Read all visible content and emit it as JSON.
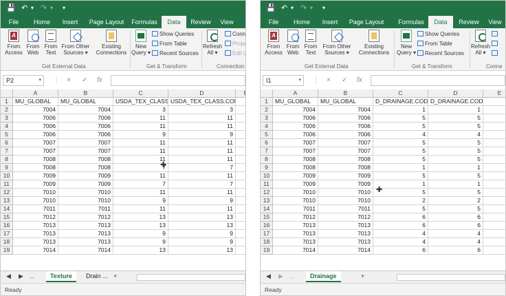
{
  "qat": {
    "save_icon": "save-icon",
    "undo_icon": "undo-icon",
    "redo_icon": "redo-icon",
    "customize_icon": "customize-qat-icon"
  },
  "tabs": [
    "File",
    "Home",
    "Insert",
    "Page Layout",
    "Formulas",
    "Data",
    "Review",
    "View"
  ],
  "ribbon": {
    "from_access": "From\nAccess",
    "from_web": "From\nWeb",
    "from_text": "From\nText",
    "from_other": "From Other\nSources ▾",
    "existing": "Existing\nConnections",
    "get_external": "Get External Data",
    "new_query": "New\nQuery ▾",
    "show_queries": "Show Queries",
    "from_table": "From Table",
    "recent_sources": "Recent Sources",
    "get_transform": "Get & Transform",
    "refresh": "Refresh\nAll ▾",
    "connections_a": "Conne",
    "properties_a": "Prope",
    "edit_links_a": "Edit Li",
    "connections_label_a": "Connection",
    "connections_label_b": "Conne"
  },
  "formula_bar": {
    "a_cell": "P2",
    "b_cell": "I1",
    "cancel": "×",
    "enter": "✓",
    "fx": "fx"
  },
  "col_headers_a": [
    "A",
    "B",
    "C",
    "D",
    "E"
  ],
  "col_headers_b": [
    "A",
    "B",
    "C",
    "D",
    "E"
  ],
  "header_row_a": [
    "MU_GLOBAL",
    "MU_GLOBAL",
    "USDA_TEX_CLASS.CO",
    "USDA_TEX_CLASS.CODE",
    ""
  ],
  "header_row_b": [
    "MU_GLOBAL",
    "MU_GLOBAL",
    "D_DRAINAGE.CODE",
    "D_DRAINAGE.CODE",
    ""
  ],
  "rows_a": [
    [
      "7004",
      "7004",
      "3",
      "3"
    ],
    [
      "7006",
      "7006",
      "11",
      "11"
    ],
    [
      "7006",
      "7006",
      "11",
      "11"
    ],
    [
      "7006",
      "7006",
      "9",
      "9"
    ],
    [
      "7007",
      "7007",
      "11",
      "11"
    ],
    [
      "7007",
      "7007",
      "11",
      "11"
    ],
    [
      "7008",
      "7008",
      "11",
      "11"
    ],
    [
      "7008",
      "7008",
      "7",
      "7"
    ],
    [
      "7009",
      "7009",
      "11",
      "11"
    ],
    [
      "7009",
      "7009",
      "7",
      "7"
    ],
    [
      "7010",
      "7010",
      "11",
      "11"
    ],
    [
      "7010",
      "7010",
      "9",
      "9"
    ],
    [
      "7011",
      "7011",
      "11",
      "11"
    ],
    [
      "7012",
      "7012",
      "13",
      "13"
    ],
    [
      "7013",
      "7013",
      "13",
      "13"
    ],
    [
      "7013",
      "7013",
      "9",
      "9"
    ],
    [
      "7013",
      "7013",
      "9",
      "9"
    ],
    [
      "7014",
      "7014",
      "13",
      "13"
    ]
  ],
  "rows_b": [
    [
      "7004",
      "7004",
      "1",
      "1"
    ],
    [
      "7006",
      "7006",
      "5",
      "5"
    ],
    [
      "7006",
      "7006",
      "5",
      "5"
    ],
    [
      "7006",
      "7006",
      "4",
      "4"
    ],
    [
      "7007",
      "7007",
      "5",
      "5"
    ],
    [
      "7007",
      "7007",
      "5",
      "5"
    ],
    [
      "7008",
      "7008",
      "5",
      "5"
    ],
    [
      "7008",
      "7008",
      "1",
      "1"
    ],
    [
      "7009",
      "7009",
      "5",
      "5"
    ],
    [
      "7009",
      "7009",
      "1",
      "1"
    ],
    [
      "7010",
      "7010",
      "5",
      "5"
    ],
    [
      "7010",
      "7010",
      "2",
      "2"
    ],
    [
      "7011",
      "7011",
      "5",
      "5"
    ],
    [
      "7012",
      "7012",
      "6",
      "6"
    ],
    [
      "7013",
      "7013",
      "6",
      "6"
    ],
    [
      "7013",
      "7013",
      "4",
      "4"
    ],
    [
      "7013",
      "7013",
      "4",
      "4"
    ],
    [
      "7014",
      "7014",
      "6",
      "6"
    ]
  ],
  "sheets_a": {
    "ellipsis": "...",
    "active": "Texture",
    "other": "Drain ...",
    "add": "+"
  },
  "sheets_b": {
    "ellipsis": "...",
    "active": "Drainage",
    "add": "+"
  },
  "status": "Ready"
}
